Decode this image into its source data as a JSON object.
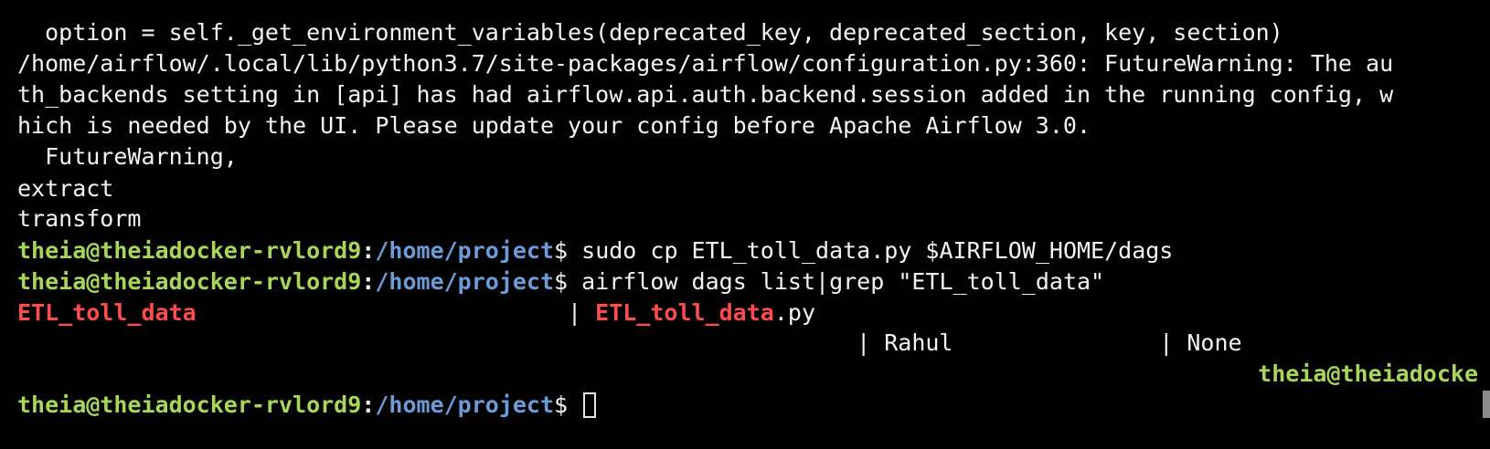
{
  "terminal": {
    "output_lines": [
      "  option = self._get_environment_variables(deprecated_key, deprecated_section, key, section)",
      "/home/airflow/.local/lib/python3.7/site-packages/airflow/configuration.py:360: FutureWarning: The au",
      "th_backends setting in [api] has had airflow.api.auth.backend.session added in the running config, w",
      "hich is needed by the UI. Please update your config before Apache Airflow 3.0.",
      "  FutureWarning,",
      "extract",
      "transform"
    ],
    "prompt": {
      "user_host": "theia@theiadocker-rvlord9",
      "colon": ":",
      "path": "/home/project",
      "dollar": "$"
    },
    "commands": [
      " sudo cp ETL_toll_data.py $AIRFLOW_HOME/dags",
      " airflow dags list|grep \"ETL_toll_data\""
    ],
    "grep_result": {
      "dag_id": "ETL_toll_data",
      "separator_1": "                           | ",
      "filepath_match": "ETL_toll_data",
      "filepath_rest": ".py",
      "second_line": "                                                             | Rahul               | None",
      "wrapped_prompt": "theia@theiadocke"
    },
    "cursor_label": "cursor",
    "colors": {
      "background": "#000000",
      "text": "#f4f4f4",
      "prompt_user": "#a8d65c",
      "prompt_path": "#6d9bd6",
      "grep_match": "#ff4d4d"
    }
  }
}
